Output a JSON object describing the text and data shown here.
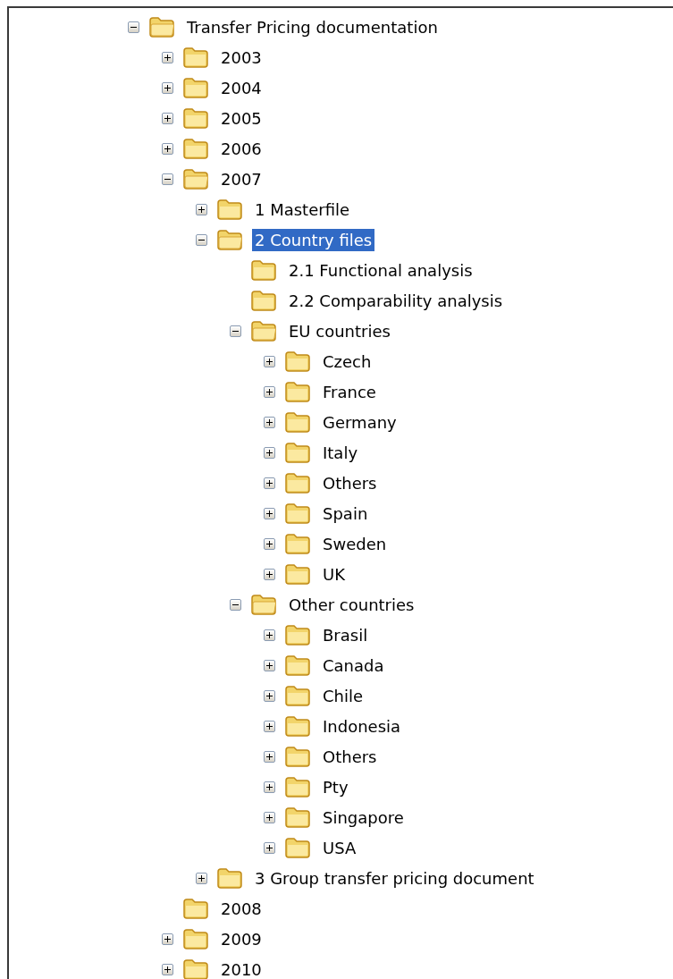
{
  "tree": {
    "nodes": [
      {
        "label": "Transfer Pricing documentation",
        "expandable": true,
        "expanded": true,
        "selected": false,
        "children": [
          {
            "label": "2003",
            "expandable": true,
            "expanded": false,
            "selected": false
          },
          {
            "label": "2004",
            "expandable": true,
            "expanded": false,
            "selected": false
          },
          {
            "label": "2005",
            "expandable": true,
            "expanded": false,
            "selected": false
          },
          {
            "label": "2006",
            "expandable": true,
            "expanded": false,
            "selected": false
          },
          {
            "label": "2007",
            "expandable": true,
            "expanded": true,
            "selected": false,
            "children": [
              {
                "label": "1 Masterfile",
                "expandable": true,
                "expanded": false,
                "selected": false
              },
              {
                "label": "2 Country files",
                "expandable": true,
                "expanded": true,
                "selected": true,
                "children": [
                  {
                    "label": "2.1 Functional analysis",
                    "expandable": false,
                    "expanded": false,
                    "selected": false
                  },
                  {
                    "label": "2.2 Comparability analysis",
                    "expandable": false,
                    "expanded": false,
                    "selected": false
                  },
                  {
                    "label": "EU countries",
                    "expandable": true,
                    "expanded": true,
                    "selected": false,
                    "children": [
                      {
                        "label": "Czech",
                        "expandable": true,
                        "expanded": false,
                        "selected": false
                      },
                      {
                        "label": "France",
                        "expandable": true,
                        "expanded": false,
                        "selected": false
                      },
                      {
                        "label": "Germany",
                        "expandable": true,
                        "expanded": false,
                        "selected": false
                      },
                      {
                        "label": "Italy",
                        "expandable": true,
                        "expanded": false,
                        "selected": false
                      },
                      {
                        "label": "Others",
                        "expandable": true,
                        "expanded": false,
                        "selected": false
                      },
                      {
                        "label": "Spain",
                        "expandable": true,
                        "expanded": false,
                        "selected": false
                      },
                      {
                        "label": "Sweden",
                        "expandable": true,
                        "expanded": false,
                        "selected": false
                      },
                      {
                        "label": "UK",
                        "expandable": true,
                        "expanded": false,
                        "selected": false
                      }
                    ]
                  },
                  {
                    "label": "Other countries",
                    "expandable": true,
                    "expanded": true,
                    "selected": false,
                    "children": [
                      {
                        "label": "Brasil",
                        "expandable": true,
                        "expanded": false,
                        "selected": false
                      },
                      {
                        "label": "Canada",
                        "expandable": true,
                        "expanded": false,
                        "selected": false
                      },
                      {
                        "label": "Chile",
                        "expandable": true,
                        "expanded": false,
                        "selected": false
                      },
                      {
                        "label": "Indonesia",
                        "expandable": true,
                        "expanded": false,
                        "selected": false
                      },
                      {
                        "label": "Others",
                        "expandable": true,
                        "expanded": false,
                        "selected": false
                      },
                      {
                        "label": "Pty",
                        "expandable": true,
                        "expanded": false,
                        "selected": false
                      },
                      {
                        "label": "Singapore",
                        "expandable": true,
                        "expanded": false,
                        "selected": false
                      },
                      {
                        "label": "USA",
                        "expandable": true,
                        "expanded": false,
                        "selected": false
                      }
                    ]
                  }
                ]
              },
              {
                "label": "3 Group transfer pricing document",
                "expandable": true,
                "expanded": false,
                "selected": false
              }
            ]
          },
          {
            "label": "2008",
            "expandable": false,
            "expanded": false,
            "selected": false
          },
          {
            "label": "2009",
            "expandable": true,
            "expanded": false,
            "selected": false
          },
          {
            "label": "2010",
            "expandable": true,
            "expanded": false,
            "selected": false
          }
        ]
      }
    ]
  }
}
